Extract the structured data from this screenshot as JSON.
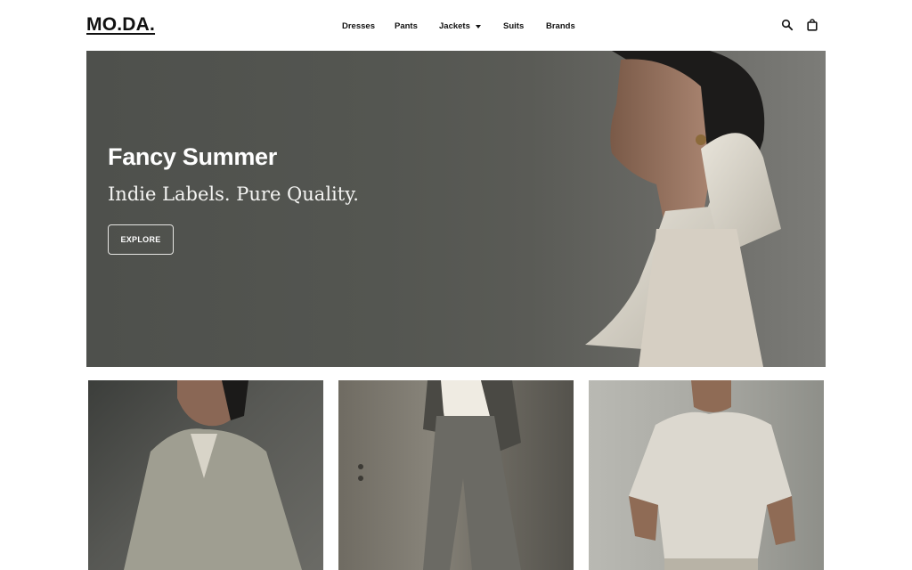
{
  "brand": {
    "logo": "MO.DA."
  },
  "nav": {
    "items": [
      {
        "label": "Dresses"
      },
      {
        "label": "Pants"
      },
      {
        "label": "Jackets",
        "has_dropdown": true
      },
      {
        "label": "Suits"
      },
      {
        "label": "Brands"
      }
    ]
  },
  "header_icons": {
    "search": "search-icon",
    "cart": "shopping-bag-icon"
  },
  "hero": {
    "headline": "Fancy Summer",
    "subheadline": "Indie Labels. Pure Quality.",
    "cta_label": "EXPLORE"
  },
  "products": [
    {
      "image": "woman-in-grey-blazer"
    },
    {
      "image": "person-in-grey-wide-trousers"
    },
    {
      "image": "man-in-cream-tshirt"
    }
  ],
  "colors": {
    "text": "#111111",
    "hero_bg": "#545651",
    "hero_text": "#ffffff",
    "cta_border": "#e6e6e3"
  }
}
